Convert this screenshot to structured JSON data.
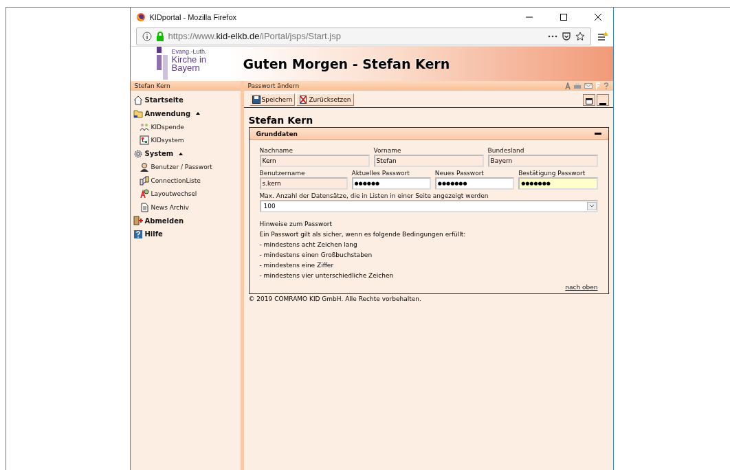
{
  "window": {
    "title": "KIDportal - Mozilla Firefox"
  },
  "address_bar": {
    "prefix": "https://www.",
    "domain": "kid-elkb.de",
    "path": "/iPortal/jsps/Start.jsp"
  },
  "logo": {
    "line_1": "Evang.-Luth.",
    "line_2": "Kirche in",
    "line_3": "Bayern"
  },
  "banner": {
    "greeting": "Guten Morgen -  Stefan Kern"
  },
  "sidebar": {
    "user": "Stefan Kern",
    "items": [
      {
        "label": "Startseite",
        "kind": "home"
      },
      {
        "label": "Anwendung",
        "kind": "folder",
        "expanded": true,
        "children": [
          {
            "label": "KIDspende",
            "kind": "people"
          },
          {
            "label": "KIDsystem",
            "kind": "tree"
          }
        ]
      },
      {
        "label": "System",
        "kind": "gear",
        "expanded": true,
        "children": [
          {
            "label": "Benutzer / Passwort",
            "kind": "user"
          },
          {
            "label": "ConnectionListe",
            "kind": "connection"
          },
          {
            "label": "Layoutwechsel",
            "kind": "layout"
          },
          {
            "label": "News Archiv",
            "kind": "document"
          }
        ]
      },
      {
        "label": "Abmelden",
        "kind": "exit"
      },
      {
        "label": "Hilfe",
        "kind": "help"
      }
    ]
  },
  "page": {
    "title": "Passwort ändern",
    "toolbar": [
      {
        "label": "Speichern",
        "kind": "save"
      },
      {
        "label": "Zurücksetzen",
        "kind": "reset"
      }
    ],
    "heading": "Stefan Kern",
    "section": {
      "title": "Grunddaten",
      "rows": [
        [
          {
            "label": "Nachname",
            "value": "Kern",
            "disabled": true
          },
          {
            "label": "Vorname",
            "value": "Stefan",
            "disabled": true
          },
          {
            "label": "Bundesland",
            "value": "Bayern",
            "disabled": true
          }
        ],
        [
          {
            "label": "Benutzername",
            "value": "s.kern",
            "disabled": true,
            "focused": false
          },
          {
            "label": "Aktuelles Passwort",
            "value": "●●●●●●",
            "disabled": false,
            "focused": false
          },
          {
            "label": "Neues Passwort",
            "value": "●●●●●●●",
            "disabled": false,
            "focused": false
          },
          {
            "label": "Bestätigung Passwort",
            "value": "●●●●●●●",
            "disabled": false,
            "focused": true
          }
        ]
      ],
      "select": {
        "label": "Max. Anzahl der Datensätze, die in Listen in einer Seite angezeigt werden",
        "value": "100"
      },
      "hints": [
        "Hinweise zum Passwort",
        "Ein Passwort gilt als sicher, wenn es folgende Bedingungen erfüllt:",
        "- mindestens acht Zeichen lang",
        "- mindestens einen Großbuchstaben",
        "- mindestens eine Ziffer",
        "- mindestens vier unterschiedliche Zeichen"
      ],
      "top_link": "nach oben"
    },
    "footer": "© 2019 COMRAMO KID GmbH. Alle Rechte vorbehalten."
  }
}
